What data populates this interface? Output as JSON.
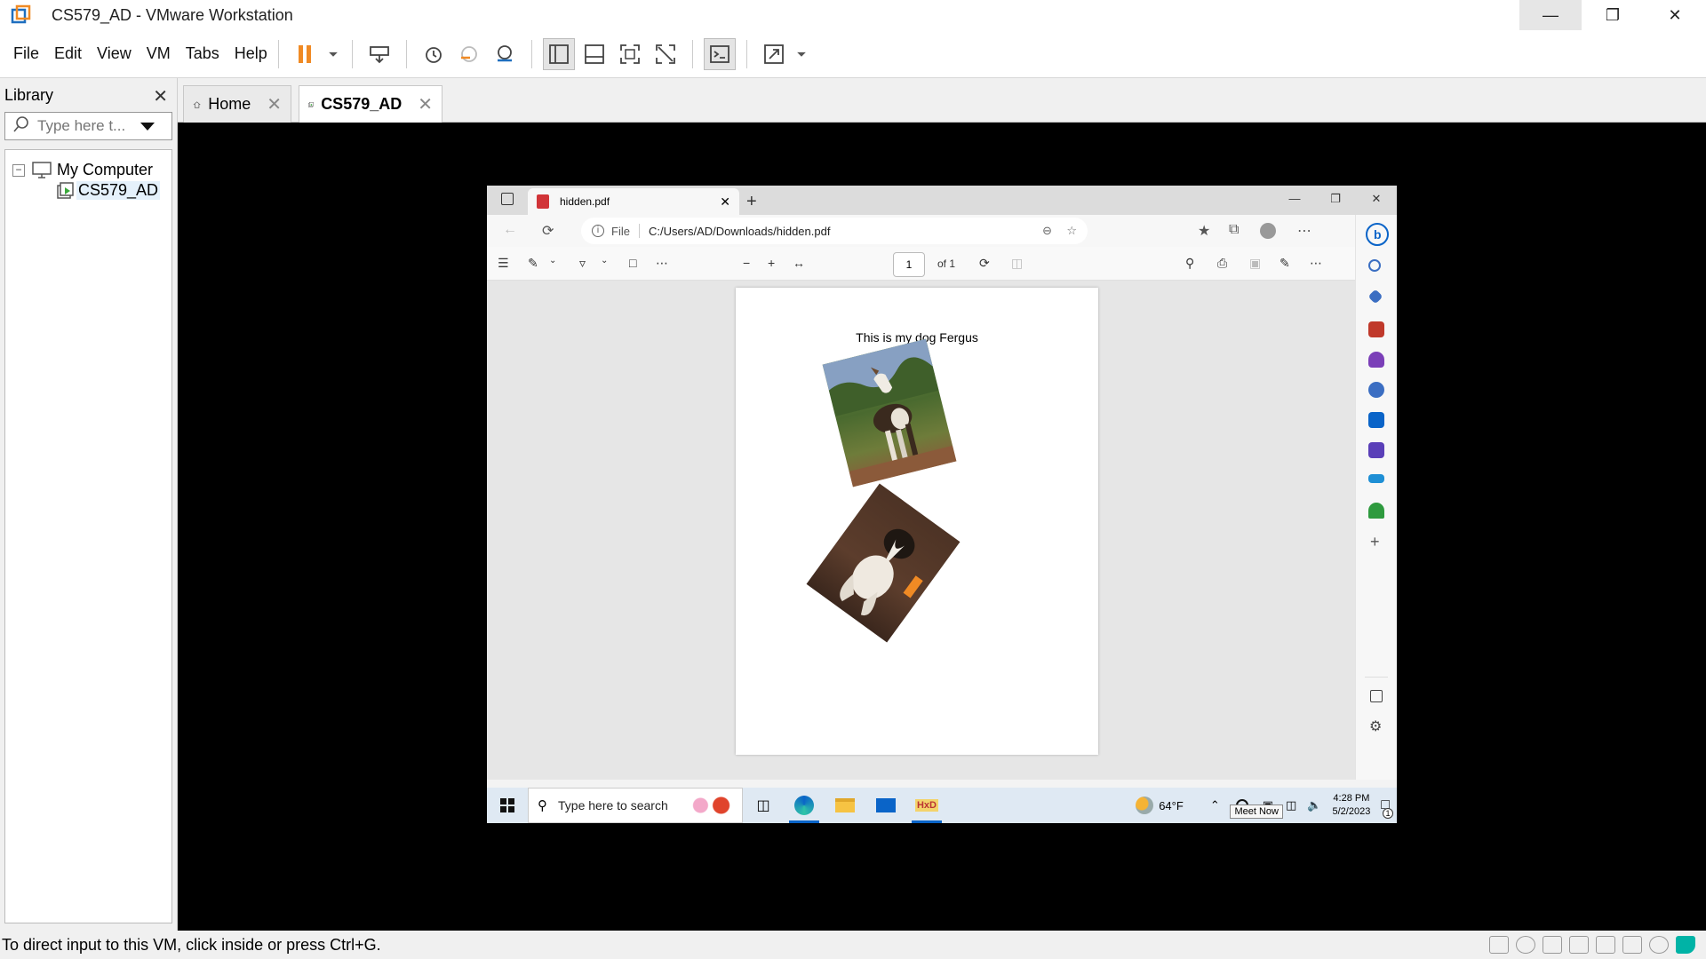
{
  "window": {
    "title": "CS579_AD - VMware Workstation",
    "controls": [
      "minimize",
      "restore",
      "close"
    ]
  },
  "menu": [
    "File",
    "Edit",
    "View",
    "VM",
    "Tabs",
    "Help"
  ],
  "toolbar_icons": [
    "pause-icon",
    "dropdown-icon",
    "send-ctrl-alt-del-icon",
    "snapshot-icon",
    "revert-snapshot-icon",
    "snapshot-manager-icon",
    "show-library-icon",
    "thumbnail-bar-icon",
    "full-screen-icon",
    "unity-icon",
    "console-icon",
    "stretch-icon"
  ],
  "library": {
    "title": "Library",
    "search_placeholder": "Type here t...",
    "tree": [
      {
        "label": "My Computer",
        "icon": "computer-icon",
        "expanded": true
      },
      {
        "label": "CS579_AD",
        "icon": "vm-running-icon",
        "selected": true
      }
    ]
  },
  "tabs": [
    {
      "label": "Home",
      "icon": "home-icon",
      "active": false
    },
    {
      "label": "CS579_AD",
      "icon": "vm-running-icon",
      "active": true
    }
  ],
  "guest": {
    "browser_tab": {
      "label": "hidden.pdf",
      "icon": "pdf-icon"
    },
    "address": {
      "scheme_label": "File",
      "url": "C:/Users/AD/Downloads/hidden.pdf"
    },
    "pdf_toolbar": {
      "page_current": "1",
      "page_total_label": "of 1"
    },
    "pdf": {
      "caption": "This is my dog Fergus"
    },
    "taskbar": {
      "search_placeholder": "Type here to search",
      "weather": "64°F",
      "time": "4:28 PM",
      "date": "5/2/2023",
      "tooltip": "Meet Now",
      "notification_count": "1"
    }
  },
  "status": {
    "message": "To direct input to this VM, click inside or press Ctrl+G."
  },
  "colors": {
    "accent_orange": "#f08a24",
    "vmware_blue": "#1f6fbf",
    "edge_blue": "#0a64c8",
    "vm_background": "#000000"
  }
}
